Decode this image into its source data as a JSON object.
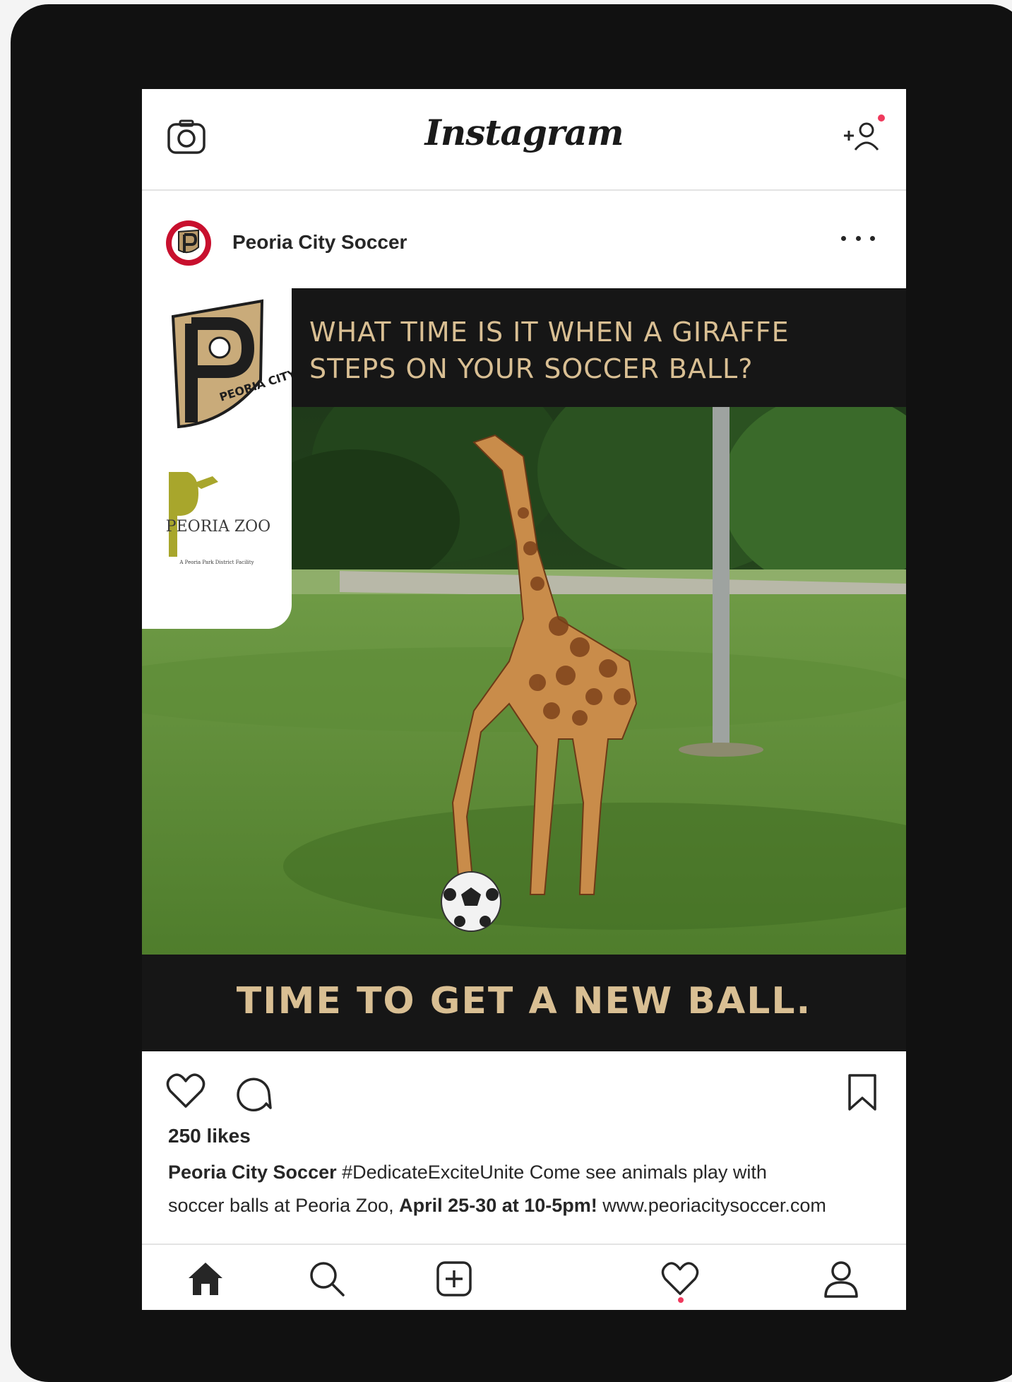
{
  "app": {
    "title": "Instagram"
  },
  "post": {
    "username": "Peoria City Soccer",
    "image": {
      "headline_line1": "WHAT TIME IS IT WHEN A GIRAFFE",
      "headline_line2": "STEPS ON YOUR SOCCER BALL?",
      "punchline": "TIME TO GET A NEW BALL.",
      "logo_peoria_city": "PEORIA CITY",
      "logo_zoo_name": "PEORIA ZOO",
      "logo_zoo_tagline": "A Peoria Park District Facility"
    },
    "likes": "250 likes",
    "caption": {
      "author": "Peoria City Soccer",
      "text1": " #DedicateExciteUnite Come see animals play with",
      "text2": "soccer balls at Peoria Zoo, ",
      "emphasis": "April 25-30 at 10-5pm!",
      "text3": " www.peoriacitysoccer.com"
    }
  },
  "icons": {
    "top": [
      "camera-icon",
      "add-user-icon"
    ],
    "actions": [
      "heart-icon",
      "comment-icon",
      "bookmark-icon"
    ],
    "nav": [
      "home-icon",
      "search-icon",
      "add-post-icon",
      "activity-heart-icon",
      "profile-icon"
    ]
  },
  "colors": {
    "brand_gold": "#d9bf93",
    "band_black": "#161616",
    "notification_red": "#ef3a5d",
    "club_red": "#c8102e"
  }
}
